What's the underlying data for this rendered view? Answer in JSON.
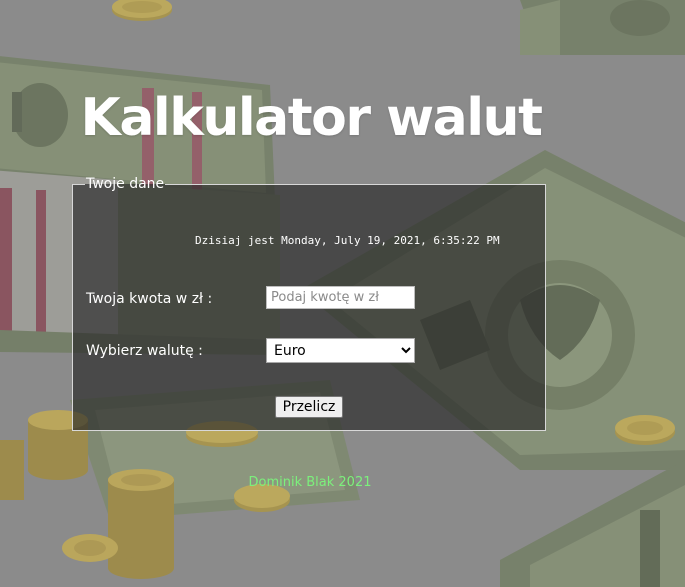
{
  "page": {
    "title": "Kalkulator walut"
  },
  "form": {
    "legend": "Twoje dane",
    "date_text": "Dzisiaj jest Monday, July 19, 2021, 6:35:22 PM",
    "amount_label": "Twoja kwota w zł :",
    "amount_placeholder": "Podaj kwotę w zł",
    "amount_value": "",
    "currency_label": "Wybierz walutę :",
    "currency_selected": "Euro",
    "submit_label": "Przelicz"
  },
  "footer": {
    "text": "Dominik Blak 2021"
  },
  "colors": {
    "background": "#8a8a8a",
    "panel": "#282828",
    "footer_text": "#7cf07c"
  },
  "icons": {
    "select_arrow": "chevron-down-icon",
    "decor": [
      "banknote-icon",
      "coin-stack-icon"
    ]
  }
}
